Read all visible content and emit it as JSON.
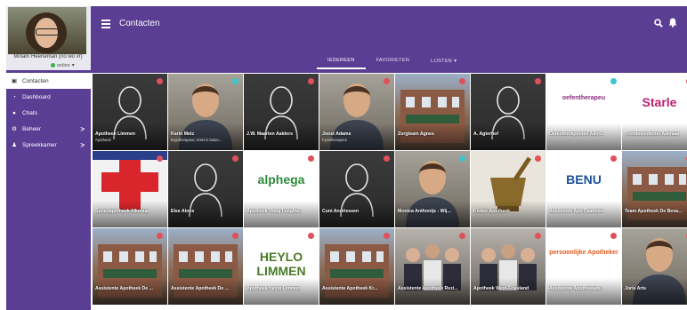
{
  "profile": {
    "name": "Miriam Heeneman (no wo vr)",
    "status": "online"
  },
  "nav": {
    "items": [
      {
        "label": "Contacten",
        "icon": "contacts-icon",
        "active": true
      },
      {
        "label": "Dashboard",
        "icon": "dashboard-icon",
        "active": false
      },
      {
        "label": "Chats",
        "icon": "chat-icon",
        "active": false
      },
      {
        "label": "Beheer",
        "icon": "settings-icon",
        "active": false,
        "chevron": ">"
      },
      {
        "label": "Spreekkamer",
        "icon": "user-icon",
        "active": false,
        "chevron": ">"
      }
    ]
  },
  "header": {
    "title": "Contacten",
    "tabs": [
      {
        "label": "IEDEREEN",
        "active": true
      },
      {
        "label": "FAVORIETEN",
        "active": false
      },
      {
        "label": "LIJSTEN",
        "active": false,
        "chevron": "⌄"
      }
    ]
  },
  "colors": {
    "accent": "#5a3e93",
    "favorite_red": "#e0505a",
    "favorite_teal": "#3fc3cf",
    "online": "#33b34a"
  },
  "contacts": [
    {
      "name": "Apotheek Limmen",
      "subtitle": "Apotheek",
      "fav": "red",
      "image": "silhouette"
    },
    {
      "name": "Karin Metz",
      "subtitle": "Ergotherapeut, Eisel in balan...",
      "fav": "teal",
      "image": "photo"
    },
    {
      "name": "J.W. Maarten Aalders",
      "subtitle": "",
      "fav": "red",
      "image": "silhouette"
    },
    {
      "name": "Joost Adams",
      "subtitle": "Fysiotherapeut",
      "fav": "red",
      "image": "photo"
    },
    {
      "name": "Zorgteam Agnes",
      "subtitle": "",
      "fav": "red",
      "image": "building"
    },
    {
      "name": "A. Agterhof",
      "subtitle": "",
      "fav": "red",
      "image": "silhouette"
    },
    {
      "name": "Oefentherapeuten Alkm...",
      "subtitle": "",
      "fav": "teal",
      "image": "logo",
      "logo_text": "oefentherapeu"
    },
    {
      "name": "Trombosedienst Alkmaar",
      "subtitle": "",
      "fav": "red",
      "image": "logo",
      "logo_text": "Starle"
    },
    {
      "name": "Spoedapotheek Alkmaar",
      "subtitle": "",
      "fav": "red",
      "image": "cross"
    },
    {
      "name": "Else Alons",
      "subtitle": "",
      "fav": "red",
      "image": "silhouette"
    },
    {
      "name": "Apotheek Hoog Leeghw...",
      "subtitle": "",
      "fav": "red",
      "image": "logo",
      "logo_text": "alphega"
    },
    {
      "name": "Cuni Andriessen",
      "subtitle": "",
      "fav": "red",
      "image": "silhouette"
    },
    {
      "name": "Monica Anthonijs - Wij...",
      "subtitle": "",
      "fav": "teal",
      "image": "photo"
    },
    {
      "name": "Kinker Apotheek",
      "subtitle": "",
      "fav": "red",
      "image": "mortar"
    },
    {
      "name": "Assistente Apo Daalmeer",
      "subtitle": "",
      "fav": "red",
      "image": "logo",
      "logo_text": "BENU"
    },
    {
      "name": "Team Apotheek De Beva...",
      "subtitle": "",
      "fav": "red",
      "image": "building"
    },
    {
      "name": "Assistente Apotheek De ...",
      "subtitle": "",
      "fav": "red",
      "image": "building"
    },
    {
      "name": "Assistente Apotheek De ...",
      "subtitle": "",
      "fav": "red",
      "image": "building"
    },
    {
      "name": "Apotheek Heylo Limmen",
      "subtitle": "",
      "fav": "red",
      "image": "logo",
      "logo_text": "HEYLO LIMMEN"
    },
    {
      "name": "Assistente Apotheek Kr...",
      "subtitle": "",
      "fav": "red",
      "image": "building"
    },
    {
      "name": "Assistente Apotheek Rezi...",
      "subtitle": "",
      "fav": "red",
      "image": "group"
    },
    {
      "name": "Apotheek West-Friesland",
      "subtitle": "",
      "fav": "red",
      "image": "group"
    },
    {
      "name": "Assistente Apotheekeb...",
      "subtitle": "",
      "fav": "red",
      "image": "logo",
      "logo_text": "persoonlijke Apotheker"
    },
    {
      "name": "Joris Arts",
      "subtitle": "",
      "fav": "red",
      "image": "photo"
    }
  ]
}
